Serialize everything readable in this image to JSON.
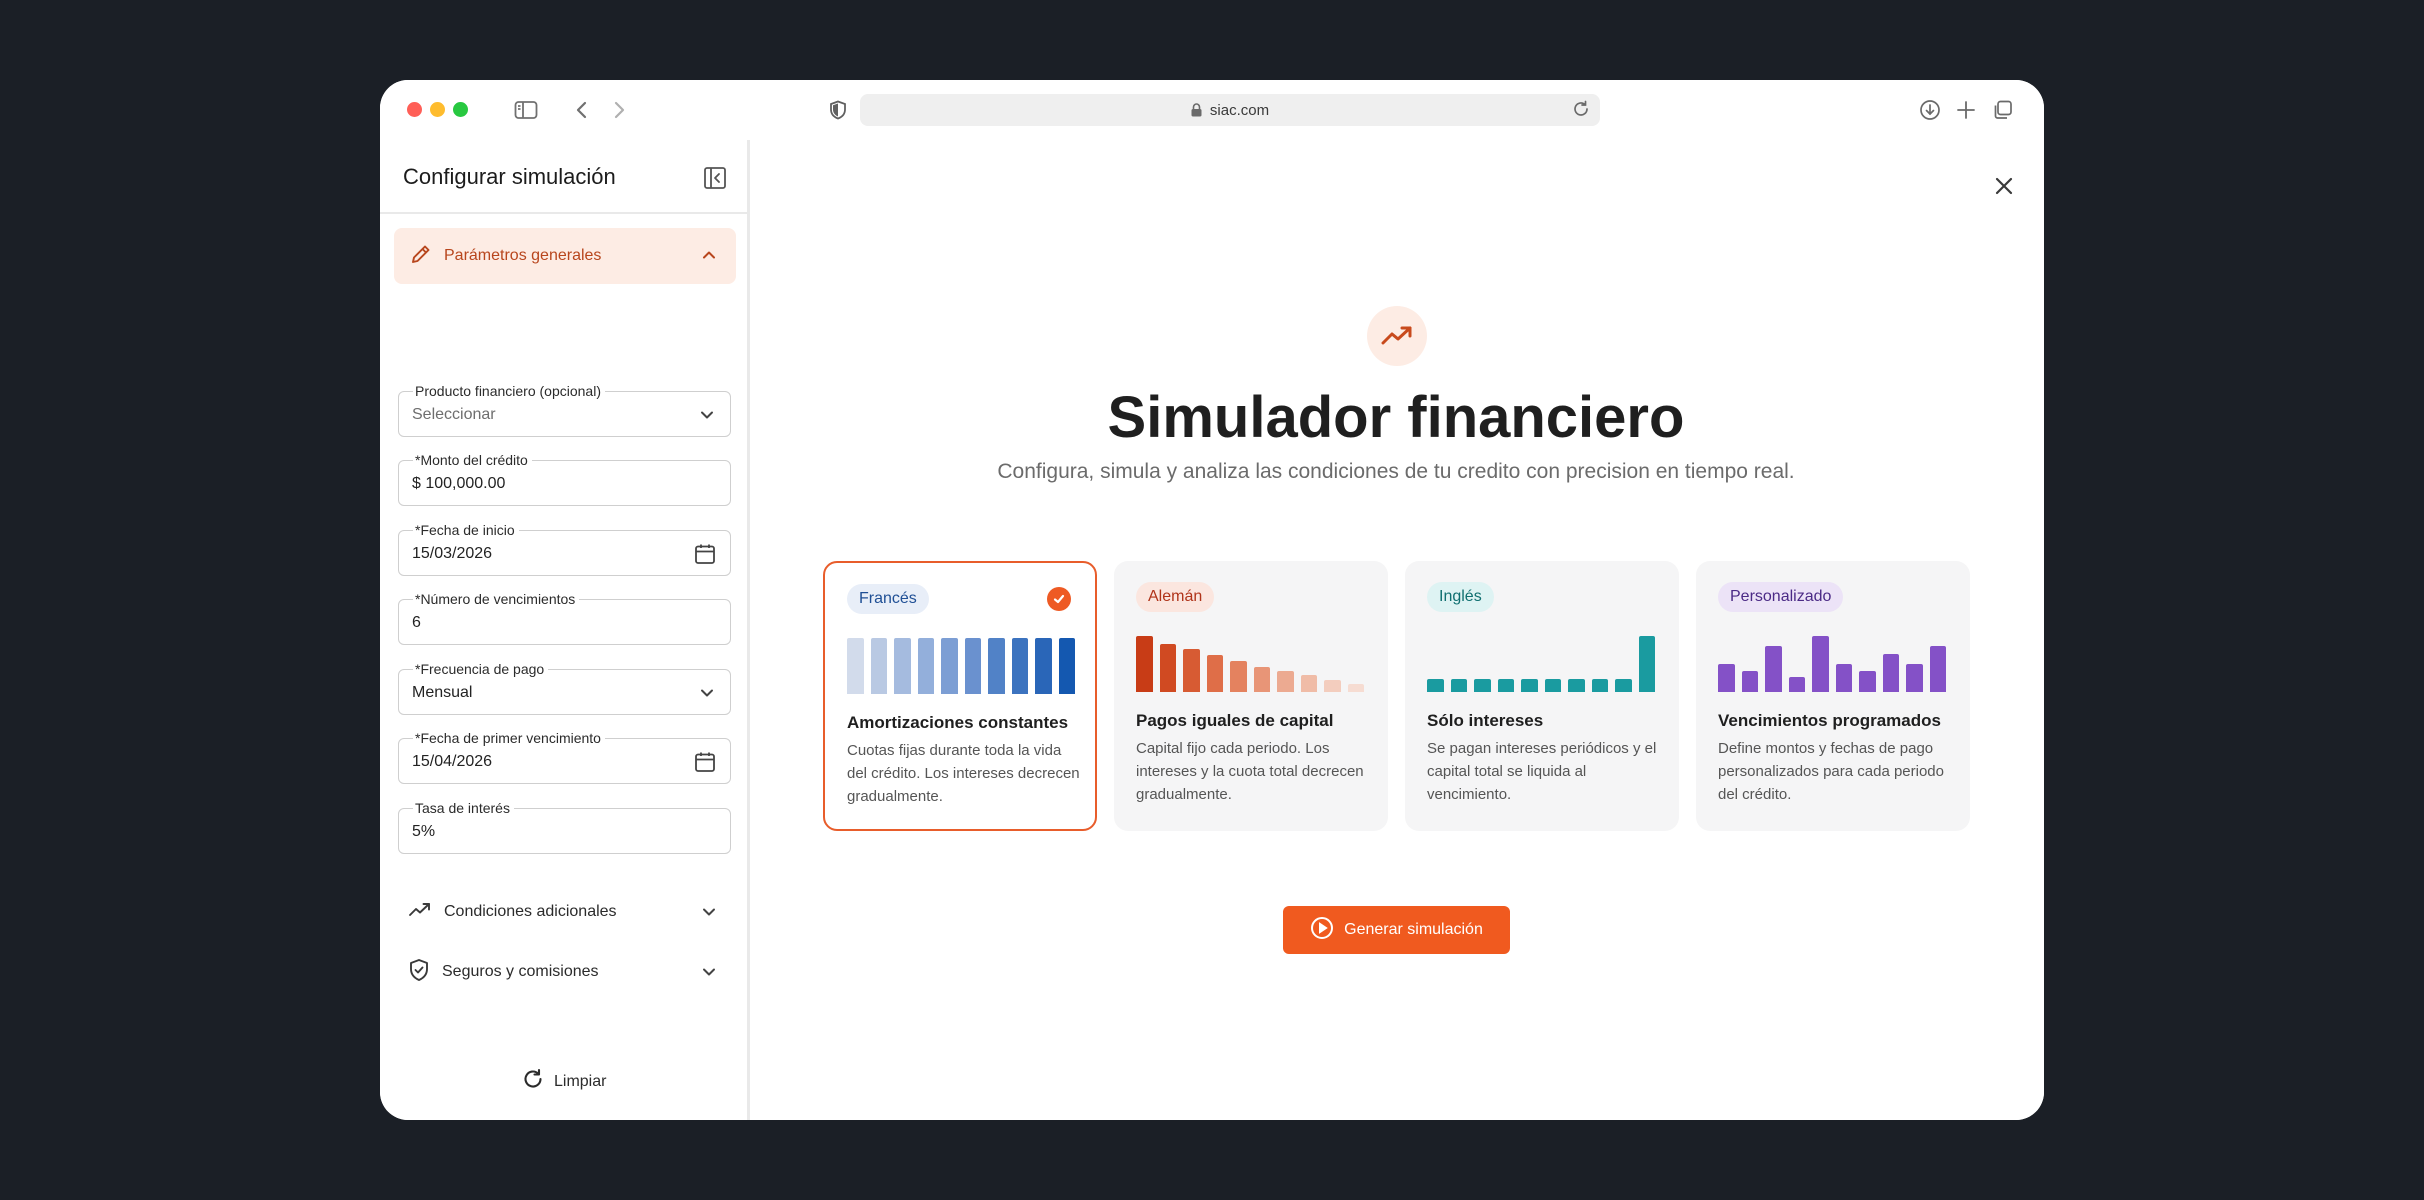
{
  "browser": {
    "url": "siac.com"
  },
  "sidebar": {
    "title": "Configurar simulación",
    "active_section": "Parámetros generales",
    "fields": {
      "producto": {
        "label": "Producto financiero (opcional)",
        "placeholder": "Seleccionar"
      },
      "monto": {
        "label": "*Monto del crédito",
        "value": "$ 100,000.00"
      },
      "fecha_inicio": {
        "label": "*Fecha de inicio",
        "value": "15/03/2026"
      },
      "vencimientos": {
        "label": "*Número de vencimientos",
        "value": "6"
      },
      "frecuencia": {
        "label": "*Frecuencia de pago",
        "value": "Mensual"
      },
      "primer_vencimiento": {
        "label": "*Fecha de primer vencimiento",
        "value": "15/04/2026"
      },
      "tasa": {
        "label": "Tasa de interés",
        "value": "5%"
      }
    },
    "sections": [
      {
        "label": "Condiciones adicionales",
        "icon": "trending-up-icon"
      },
      {
        "label": "Seguros y comisiones",
        "icon": "shield-check-icon"
      }
    ],
    "clear_label": "Limpiar"
  },
  "main": {
    "title": "Simulador financiero",
    "subtitle": "Configura, simula y analiza las condiciones de tu credito con precision en tiempo real.",
    "generate_label": "Generar simulación",
    "cards": [
      {
        "badge": "Francés",
        "badge_bg": "#e8eef8",
        "badge_fg": "#1f4f95",
        "title": "Amortizaciones constantes",
        "desc": "Cuotas fijas durante toda la vida del crédito. Los intereses decrecen gradualmente.",
        "selected": true,
        "bars": [
          1,
          1,
          1,
          1,
          1,
          1,
          1,
          1,
          1,
          1
        ],
        "colors": [
          "#d2dbeb",
          "#b9c9e3",
          "#a5bbdf",
          "#93afdb",
          "#7c9ed4",
          "#6a91cf",
          "#5182c7",
          "#3c73bf",
          "#2a66b8",
          "#1458b0"
        ]
      },
      {
        "badge": "Alemán",
        "badge_bg": "#fbe6df",
        "badge_fg": "#b0341a",
        "title": "Pagos iguales de capital",
        "desc": "Capital fijo cada periodo. Los intereses y la cuota total decrecen gradualmente.",
        "selected": false,
        "bars": [
          1,
          0.86,
          0.76,
          0.66,
          0.56,
          0.45,
          0.38,
          0.3,
          0.22,
          0.14
        ],
        "colors": [
          "#c83c16",
          "#d04a22",
          "#d75b33",
          "#df6e48",
          "#e4825f",
          "#e89577",
          "#ecaa91",
          "#f0bca7",
          "#f3cdbe",
          "#f6dcd2"
        ]
      },
      {
        "badge": "Inglés",
        "badge_bg": "#def3f3",
        "badge_fg": "#0f6f70",
        "title": "Sólo intereses",
        "desc": "Se pagan intereses periódicos y el capital total se liquida al vencimiento.",
        "selected": false,
        "bars": [
          0.24,
          0.24,
          0.24,
          0.24,
          0.24,
          0.24,
          0.24,
          0.24,
          0.24,
          1
        ],
        "colors": [
          "#1a9ba0",
          "#1a9ba0",
          "#1a9ba0",
          "#1a9ba0",
          "#1a9ba0",
          "#1a9ba0",
          "#1a9ba0",
          "#1a9ba0",
          "#1a9ba0",
          "#1a9ba0"
        ]
      },
      {
        "badge": "Personalizado",
        "badge_bg": "#ece3f7",
        "badge_fg": "#4b2a86",
        "title": "Vencimientos programados",
        "desc": "Define montos y fechas de pago personalizados para cada periodo del crédito.",
        "selected": false,
        "bars": [
          0.5,
          0.38,
          0.82,
          0.26,
          1,
          0.5,
          0.38,
          0.68,
          0.5,
          0.82
        ],
        "colors": [
          "#8451c7",
          "#8451c7",
          "#8451c7",
          "#8451c7",
          "#8451c7",
          "#8451c7",
          "#8451c7",
          "#8451c7",
          "#8451c7",
          "#8451c7"
        ]
      }
    ]
  }
}
